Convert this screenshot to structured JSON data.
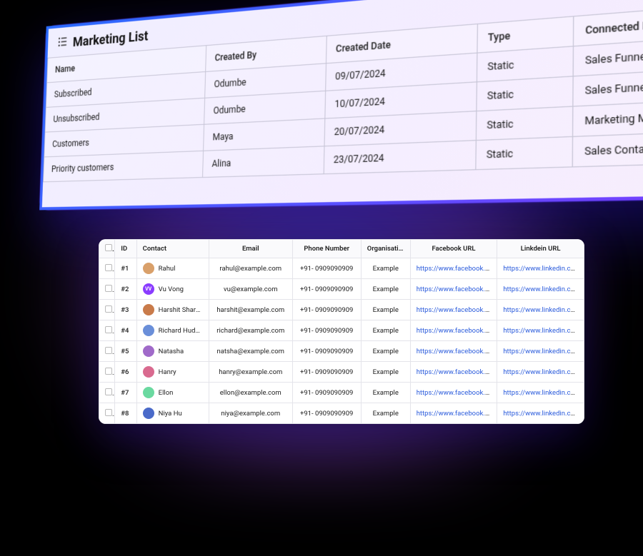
{
  "marketing_list": {
    "title": "Marketing List",
    "headers": {
      "name": "Name",
      "created_by": "Created By",
      "created_date": "Created Date",
      "type": "Type",
      "connected": "Connected Bo"
    },
    "rows": [
      {
        "name": "Subscribed",
        "created_by": "Odumbe",
        "created_date": "09/07/2024",
        "type": "Static",
        "connected": "Sales Funnel"
      },
      {
        "name": "Unsubscribed",
        "created_by": "Odumbe",
        "created_date": "10/07/2024",
        "type": "Static",
        "connected": "Sales Funnel"
      },
      {
        "name": "Customers",
        "created_by": "Maya",
        "created_date": "20/07/2024",
        "type": "Static",
        "connected": "Marketing Man"
      },
      {
        "name": "Priority customers",
        "created_by": "Alina",
        "created_date": "23/07/2024",
        "type": "Static",
        "connected": "Sales Contacts"
      }
    ]
  },
  "contacts": {
    "headers": {
      "id": "ID",
      "contact": "Contact",
      "email": "Email",
      "phone": "Phone Number",
      "organisation": "Organisation",
      "facebook": "Facebook URL",
      "linkedin": "Linkdein URL"
    },
    "rows": [
      {
        "id": "#1",
        "name": "Rahul",
        "email": "rahul@example.com",
        "phone": "+91- 0909090909",
        "organisation": "Example",
        "facebook": "https://www.facebook.com/u...",
        "linkedin": "https://www.linkedin.com/du...",
        "avatar_bg": "#d9a06a",
        "avatar_txt": ""
      },
      {
        "id": "#2",
        "name": "Vu Vong",
        "email": "vu@example.com",
        "phone": "+91- 0909090909",
        "organisation": "Example",
        "facebook": "https://www.facebook.com/u...",
        "linkedin": "https://www.linkedin.com/du...",
        "avatar_bg": "#8a3cff",
        "avatar_txt": "VV"
      },
      {
        "id": "#3",
        "name": "Harshit Sharma",
        "email": "harshit@example.com",
        "phone": "+91- 0909090909",
        "organisation": "Example",
        "facebook": "https://www.facebook.com/u...",
        "linkedin": "https://www.linkedin.com/du...",
        "avatar_bg": "#c97b4a",
        "avatar_txt": ""
      },
      {
        "id": "#4",
        "name": "Richard Hudson",
        "email": "richard@example.com",
        "phone": "+91- 0909090909",
        "organisation": "Example",
        "facebook": "https://www.facebook.com/u...",
        "linkedin": "https://www.linkedin.com/du...",
        "avatar_bg": "#6a8fd9",
        "avatar_txt": ""
      },
      {
        "id": "#5",
        "name": "Natasha",
        "email": "natsha@example.com",
        "phone": "+91- 0909090909",
        "organisation": "Example",
        "facebook": "https://www.facebook.com/u...",
        "linkedin": "https://www.linkedin.com/du...",
        "avatar_bg": "#a06ac9",
        "avatar_txt": ""
      },
      {
        "id": "#6",
        "name": "Hanry",
        "email": "hanry@example.com",
        "phone": "+91- 0909090909",
        "organisation": "Example",
        "facebook": "https://www.facebook.com/u...",
        "linkedin": "https://www.linkedin.com/du...",
        "avatar_bg": "#d96a8f",
        "avatar_txt": ""
      },
      {
        "id": "#7",
        "name": "Ellon",
        "email": "ellon@example.com",
        "phone": "+91- 0909090909",
        "organisation": "Example",
        "facebook": "https://www.facebook.com/u...",
        "linkedin": "https://www.linkedin.com/du...",
        "avatar_bg": "#6ad9a0",
        "avatar_txt": ""
      },
      {
        "id": "#8",
        "name": "Niya Hu",
        "email": "niya@example.com",
        "phone": "+91- 0909090909",
        "organisation": "Example",
        "facebook": "https://www.facebook.com/u...",
        "linkedin": "https://www.linkedin.com/du...",
        "avatar_bg": "#4a6ac9",
        "avatar_txt": ""
      }
    ]
  }
}
